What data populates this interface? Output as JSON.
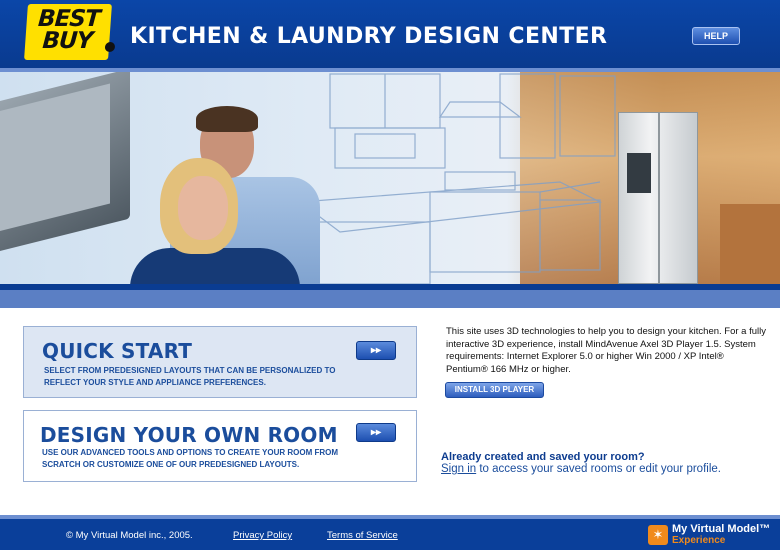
{
  "header": {
    "logo_text": "BEST BUY",
    "title": "KITCHEN & LAUNDRY DESIGN CENTER",
    "help_label": "HELP"
  },
  "quick_start": {
    "title": "QUICK START",
    "description": "SELECT FROM PREDESIGNED LAYOUTS THAT CAN BE PERSONALIZED TO REFLECT YOUR STYLE AND APPLIANCE PREFERENCES.",
    "go_label": "▸▸"
  },
  "design_room": {
    "title": "DESIGN YOUR OWN ROOM",
    "description": "USE OUR ADVANCED TOOLS AND OPTIONS TO CREATE YOUR ROOM FROM SCRATCH OR CUSTOMIZE ONE OF OUR PREDESIGNED LAYOUTS.",
    "go_label": "▸▸"
  },
  "info": {
    "text": "This site uses 3D technologies to help you to design your kitchen. For a fully interactive 3D experience, install MindAvenue Axel 3D Player 1.5. System requirements: Internet Explorer 5.0 or higher Win 2000 / XP Intel® Pentium® 166 MHz or higher.",
    "install_label": "INSTALL 3D PLAYER"
  },
  "saved": {
    "heading": "Already created and saved your room?",
    "signin_label": "Sign in",
    "rest_text": " to access your saved rooms or edit your profile."
  },
  "footer": {
    "copyright": "© My Virtual Model inc., 2005.",
    "privacy_label": "Privacy Policy",
    "terms_label": "Terms of Service",
    "mvm_brand": "My Virtual Model™",
    "mvm_sub": "Experience"
  },
  "colors": {
    "brand_blue": "#0a3f9a",
    "accent_blue": "#1b4d9c",
    "logo_yellow": "#ffe000",
    "mvm_orange": "#f08a1c"
  }
}
